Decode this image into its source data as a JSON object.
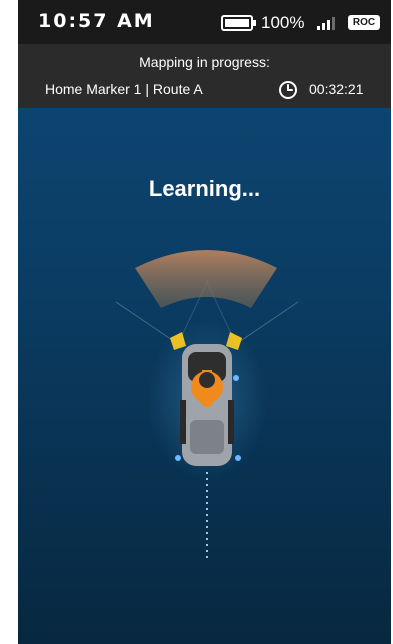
{
  "status_bar": {
    "time": "10:57 AM",
    "battery": "100%",
    "carrier_badge": "ROC"
  },
  "mapping": {
    "title": "Mapping in progress:",
    "route": "Home Marker 1 | Route A",
    "elapsed": "00:32:21"
  },
  "main": {
    "status": "Learning..."
  },
  "icons": {
    "battery": "battery-icon",
    "signal": "signal-icon",
    "clock": "clock-icon",
    "mower": "mower-icon",
    "sensor_cone": "sensor-cone-icon"
  },
  "colors": {
    "accent": "#f08a1c",
    "sensor": "#f2c21b",
    "background": "#0b3c63"
  }
}
